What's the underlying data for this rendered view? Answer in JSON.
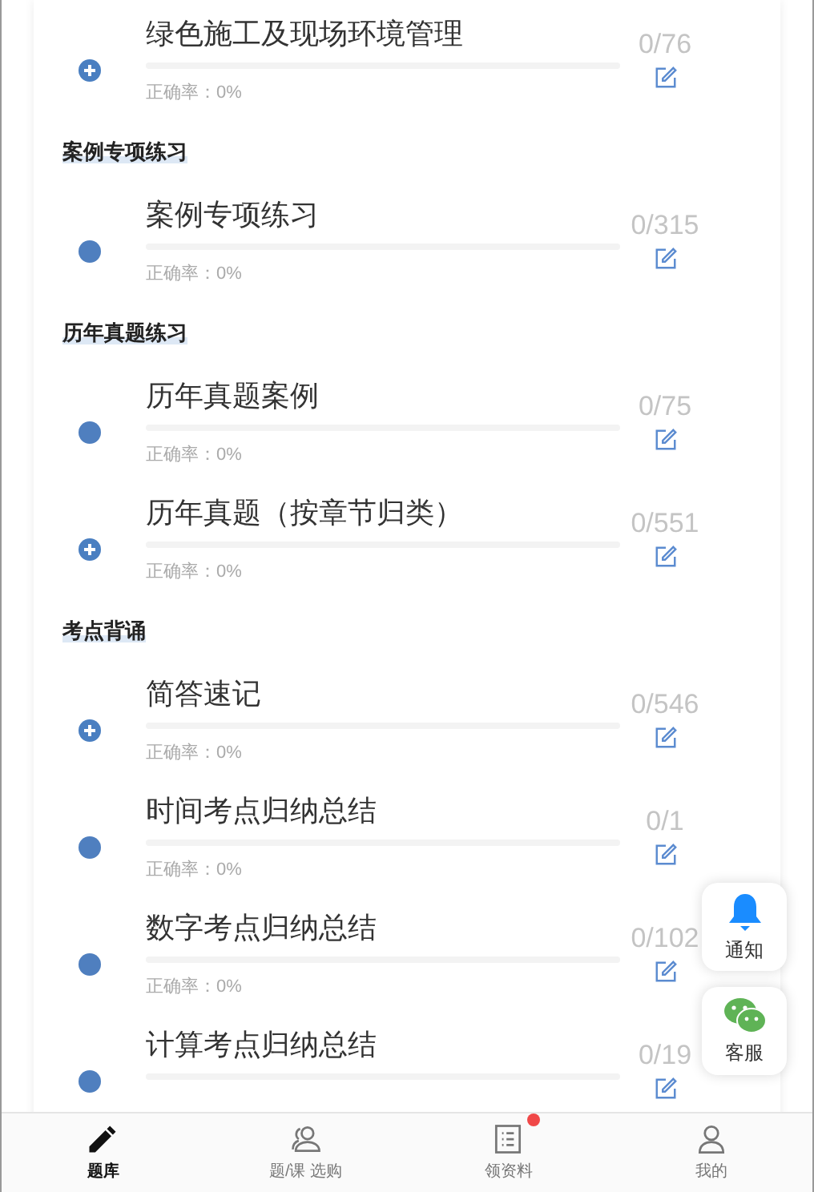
{
  "sections": [
    {
      "items": [
        {
          "kind": "group",
          "title": "绿色施工及现场环境管理",
          "accuracy": "正确率：0%",
          "count": "0/76"
        }
      ]
    },
    {
      "heading": "案例专项练习",
      "items": [
        {
          "kind": "leaf",
          "title": "案例专项练习",
          "accuracy": "正确率：0%",
          "count": "0/315"
        }
      ]
    },
    {
      "heading": "历年真题练习",
      "items": [
        {
          "kind": "leaf",
          "title": "历年真题案例",
          "accuracy": "正确率：0%",
          "count": "0/75"
        },
        {
          "kind": "group",
          "title": "历年真题（按章节归类）",
          "accuracy": "正确率：0%",
          "count": "0/551"
        }
      ]
    },
    {
      "heading": "考点背诵",
      "items": [
        {
          "kind": "group",
          "title": "简答速记",
          "accuracy": "正确率：0%",
          "count": "0/546"
        },
        {
          "kind": "leaf",
          "title": "时间考点归纳总结",
          "accuracy": "正确率：0%",
          "count": "0/1"
        },
        {
          "kind": "leaf",
          "title": "数字考点归纳总结",
          "accuracy": "正确率：0%",
          "count": "0/102"
        },
        {
          "kind": "leaf",
          "title": "计算考点归纳总结",
          "count": "0/19"
        }
      ]
    }
  ],
  "floating": [
    {
      "kind": "bell",
      "label": "通知"
    },
    {
      "kind": "chat",
      "label": "客服"
    }
  ],
  "nav": [
    {
      "kind": "pencil",
      "label": "题库",
      "selected": true,
      "dot": false
    },
    {
      "kind": "people",
      "label": "题/课 选购",
      "selected": false,
      "dot": false
    },
    {
      "kind": "list",
      "label": "领资料",
      "selected": false,
      "dot": true
    },
    {
      "kind": "person",
      "label": "我的",
      "selected": false,
      "dot": false
    }
  ]
}
